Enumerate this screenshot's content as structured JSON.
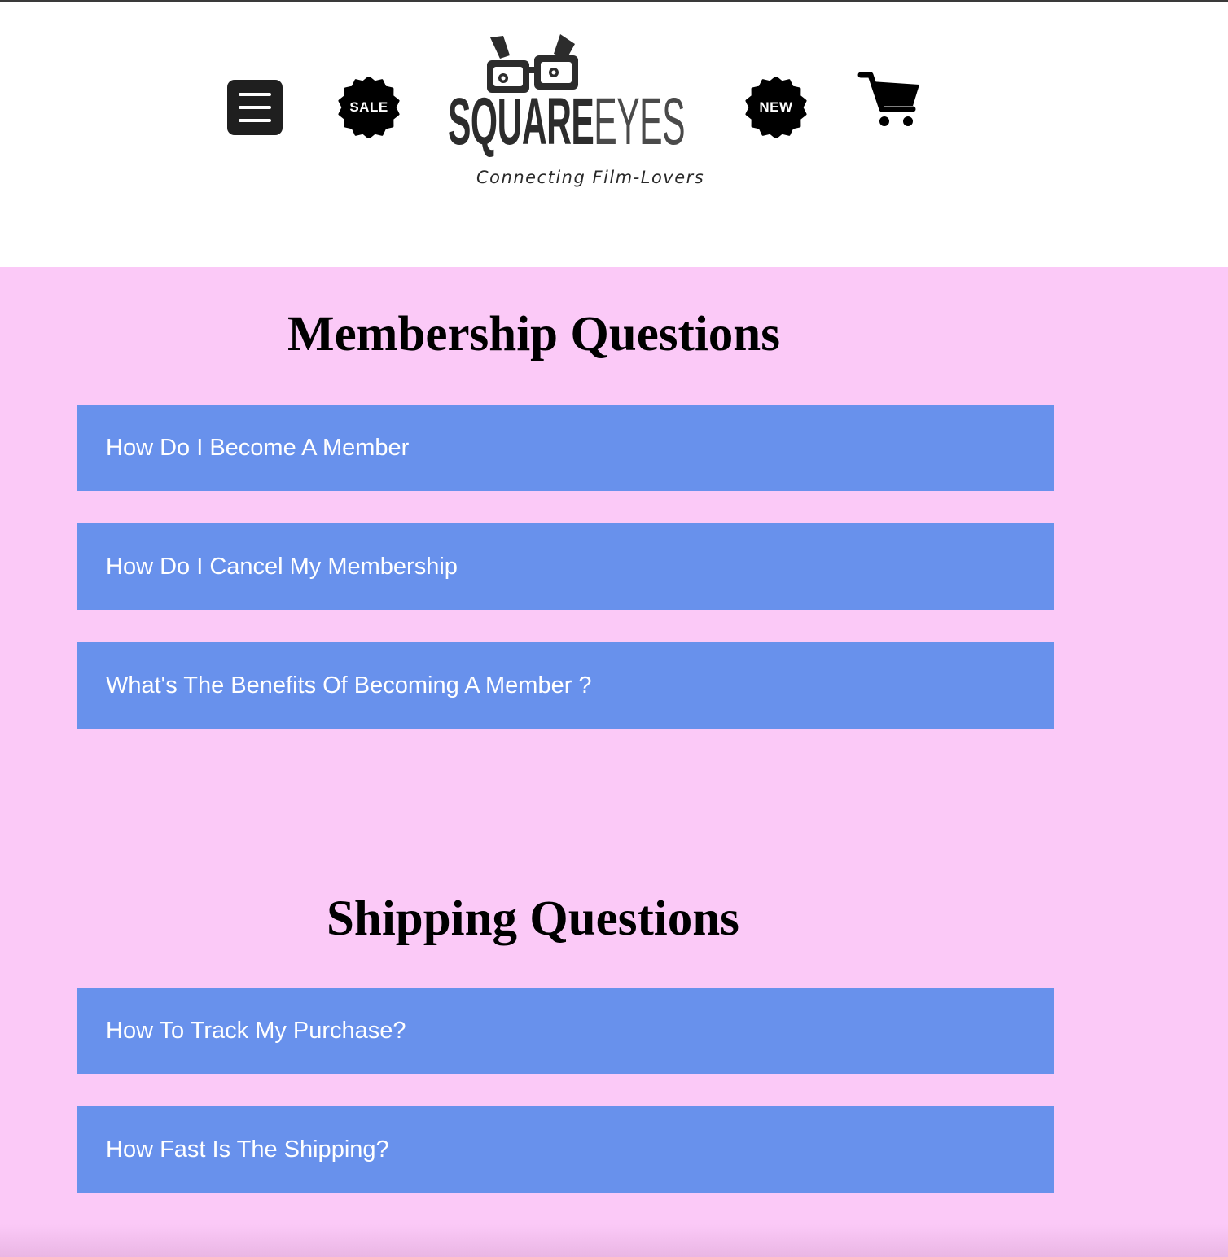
{
  "header": {
    "menu_icon": "hamburger-menu-icon",
    "sale_badge": {
      "label": "SALE",
      "icon": "starburst-badge-icon",
      "color": "#000000"
    },
    "new_badge": {
      "label": "NEW",
      "icon": "starburst-badge-icon",
      "color": "#000000"
    },
    "logo": {
      "word_primary": "SQUARE",
      "word_secondary": "EYES",
      "tagline": "Connecting Film-Lovers",
      "icon": "glasses-icon"
    },
    "cart_icon": "shopping-cart-icon"
  },
  "colors": {
    "page_background": "#fbc9f7",
    "faq_background": "#6891ec",
    "faq_text": "#ffffff",
    "heading_text": "#000000",
    "header_background": "#ffffff"
  },
  "sections": {
    "membership": {
      "heading": "Membership Questions",
      "questions": [
        "How Do I Become A Member",
        "How Do I Cancel My Membership",
        "What's The Benefits Of Becoming A Member ?"
      ]
    },
    "shipping": {
      "heading": "Shipping Questions",
      "questions": [
        "How To Track My Purchase?",
        "How Fast Is The Shipping?"
      ]
    }
  }
}
